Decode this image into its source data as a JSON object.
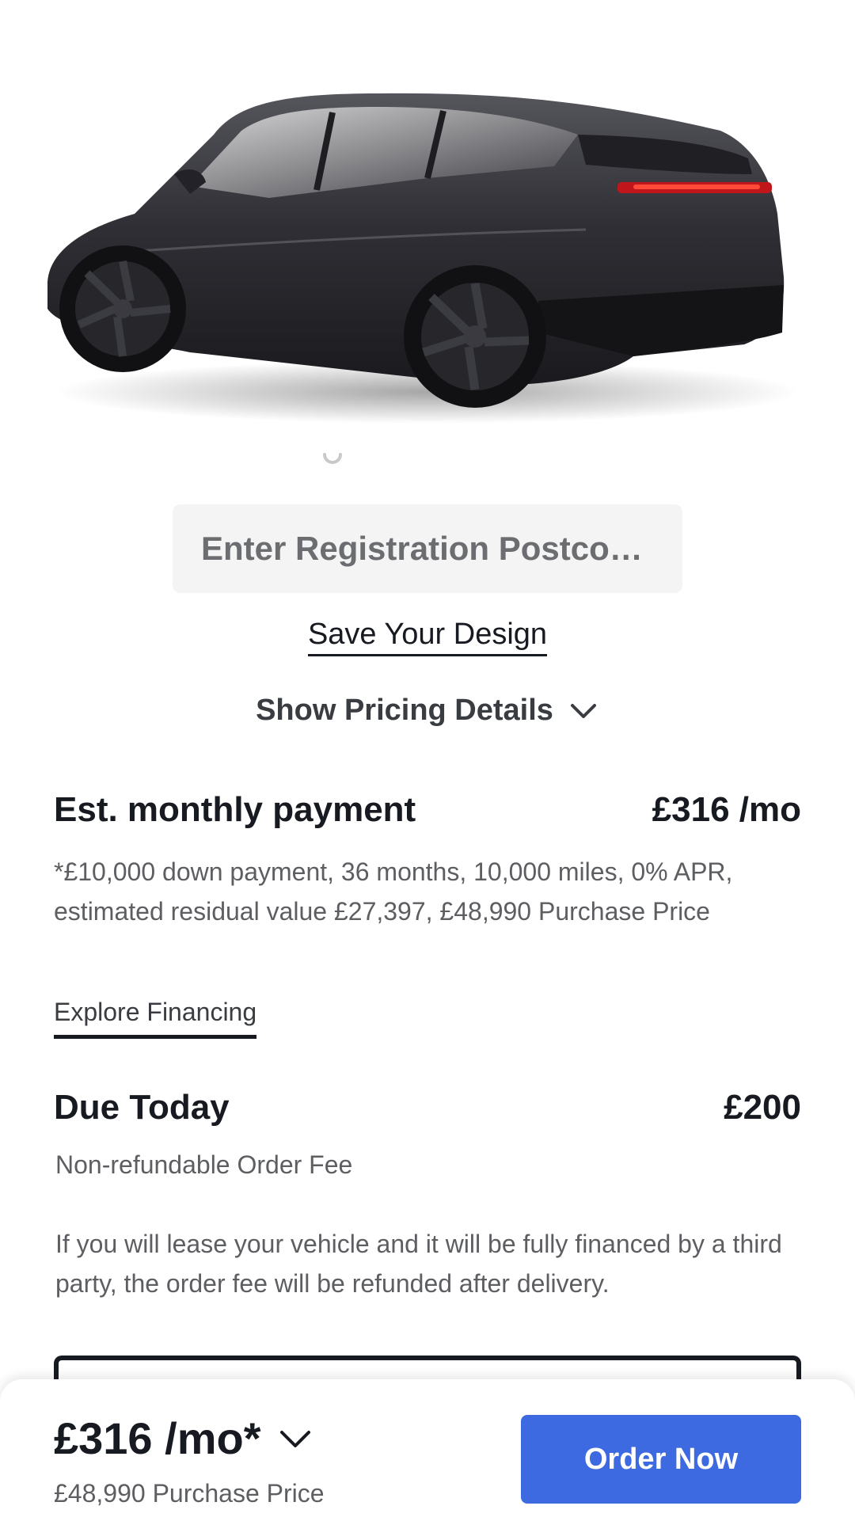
{
  "car": {
    "alt": "Model vehicle render",
    "paint_color": "#2b2b30"
  },
  "postcode": {
    "placeholder": "Enter Registration Postco…"
  },
  "links": {
    "save_design": "Save Your Design",
    "show_pricing": "Show Pricing Details",
    "explore_financing": "Explore Financing"
  },
  "monthly": {
    "title": "Est. monthly payment",
    "amount": "£316 /mo",
    "disclaimer": "*£10,000 down payment, 36 months, 10,000 miles, 0% APR, estimated residual value £27,397, £48,990 Purchase Price"
  },
  "due_today": {
    "title": "Due Today",
    "amount": "£200",
    "subtitle": "Non-refundable Order Fee",
    "note": "If you will lease your vehicle and it will be fully financed by a third party, the order fee will be refunded after delivery."
  },
  "bottom_bar": {
    "price": "£316 /mo*",
    "purchase_price": "£48,990 Purchase Price",
    "order_label": "Order Now"
  },
  "colors": {
    "accent": "#3e6ae1",
    "text_primary": "#171a20",
    "text_secondary": "#5c5e62",
    "input_bg": "#f4f4f4"
  }
}
